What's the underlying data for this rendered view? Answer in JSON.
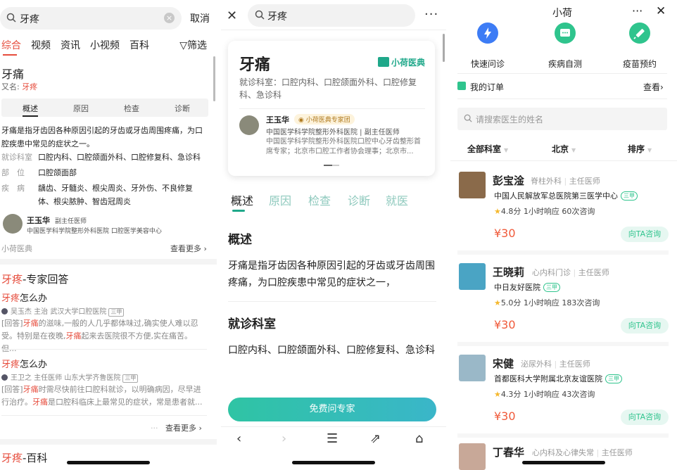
{
  "panel1": {
    "search_query": "牙疼",
    "cancel": "取消",
    "tabs": [
      "综合",
      "视频",
      "资讯",
      "小视频",
      "百科"
    ],
    "filter": "筛选",
    "card": {
      "title": "牙痛",
      "alias_label": "又名: ",
      "alias_value": "牙疼",
      "subtabs": [
        "概述",
        "原因",
        "检查",
        "诊断"
      ],
      "desc": "牙痛是指牙齿因各种原因引起的牙齿或牙齿周围疼痛，为口腔疾患中常见的症状之一。",
      "dept_label": "就诊科室",
      "dept_value": "口腔内科、口腔颌面外科、口腔修复科、急诊科",
      "part_label": "部　位",
      "part_value": "口腔颌面部",
      "disease_label": "疾　病",
      "disease_value": "龋齿、牙髓炎、根尖周炎、牙外伤、不良修复体、根尖脓肿、智齿冠周炎",
      "doctor_name": "王玉华",
      "doctor_title": "副主任医师",
      "doctor_hosp": "中国医学科学院整形外科医院 口腔医学美容中心",
      "source": "小荷医典",
      "more": "查看更多"
    },
    "expert": {
      "title_hl": "牙疼",
      "title_rest": "-专家回答",
      "items": [
        {
          "q_hl": "牙疼",
          "q_rest": "怎么办",
          "meta": "吴玉杰 主治 武汉大学口腔医院",
          "badge": "三甲",
          "ans_a": "[回答]",
          "ans_hl": "牙痛",
          "ans_b": "的滋味,一般的人几乎都体味过,确实使人难以忍受。特别是在夜晚,",
          "ans_hl2": "牙痛",
          "ans_c": "起来去医院很不方便,实在痛苦。但..."
        },
        {
          "q_hl": "牙疼",
          "q_rest": "怎么办",
          "meta": "王卫之 主任医师 山东大学齐鲁医院",
          "badge": "三甲",
          "ans_a": "[回答]",
          "ans_hl": "牙痛",
          "ans_b": "时需尽快前往口腔科就诊，以明确病因，尽早进行治疗。",
          "ans_hl2": "牙痛",
          "ans_c": "是口腔科临床上最常见的症状，常是患者就..."
        }
      ],
      "more": "查看更多"
    },
    "baike": {
      "title_hl": "牙疼",
      "title_rest": "-百科"
    }
  },
  "panel2": {
    "search_query": "牙疼",
    "card": {
      "title": "牙痛",
      "brand": "小荷医典",
      "dept": "就诊科室：口腔内科、口腔颌面外科、口腔修复科、急诊科",
      "doctor_name": "王玉华",
      "doctor_badge": "小荷医典专家团",
      "doctor_hosp": "中国医学科学院整形外科医院 | 副主任医师",
      "doctor_bio": "中国医学科学院整形外科医院口腔中心牙齿整形首席专家；北京市口腔工作者协会理事；北京市..."
    },
    "tabs": [
      "概述",
      "原因",
      "检查",
      "诊断",
      "就医"
    ],
    "sections": [
      {
        "heading": "概述",
        "body": "牙痛是指牙齿因各种原因引起的牙齿或牙齿周围疼痛，为口腔疾患中常见的症状之一，"
      },
      {
        "heading": "就诊科室",
        "body": "口腔内科、口腔颌面外科、口腔修复科、急诊科"
      }
    ],
    "cta": "免费问专家"
  },
  "panel3": {
    "title": "小荷",
    "quick": [
      {
        "label": "快速问诊",
        "color": "#3d7cf5",
        "icon": "bolt-icon"
      },
      {
        "label": "疾病自测",
        "color": "#2fc48d",
        "icon": "chat-icon"
      },
      {
        "label": "疫苗预约",
        "color": "#2fc48d",
        "icon": "syringe-icon"
      }
    ],
    "orders": "我的订单",
    "view": "查看",
    "search_placeholder": "请搜索医生的姓名",
    "filters": [
      "全部科室",
      "北京",
      "排序"
    ],
    "doctors": [
      {
        "name": "彭宝淦",
        "dept": "脊柱外科",
        "title": "主任医师",
        "hospital": "中国人民解放军总医院第三医学中心",
        "grade": "三甲",
        "rating": "4.8分",
        "response": "1小时响应",
        "consults": "60次咨询",
        "price": "¥30",
        "ask": "向TA咨询"
      },
      {
        "name": "王晓莉",
        "dept": "心内科门诊",
        "title": "主任医师",
        "hospital": "中日友好医院",
        "grade": "三甲",
        "rating": "5.0分",
        "response": "1小时响应",
        "consults": "183次咨询",
        "price": "¥30",
        "ask": "向TA咨询"
      },
      {
        "name": "宋健",
        "dept": "泌尿外科",
        "title": "主任医师",
        "hospital": "首都医科大学附属北京友谊医院",
        "grade": "三甲",
        "rating": "4.3分",
        "response": "1小时响应",
        "consults": "43次咨询",
        "price": "¥30",
        "ask": "向TA咨询"
      },
      {
        "name": "丁春华",
        "dept": "心内科及心律失常",
        "title": "主任医师"
      }
    ]
  }
}
